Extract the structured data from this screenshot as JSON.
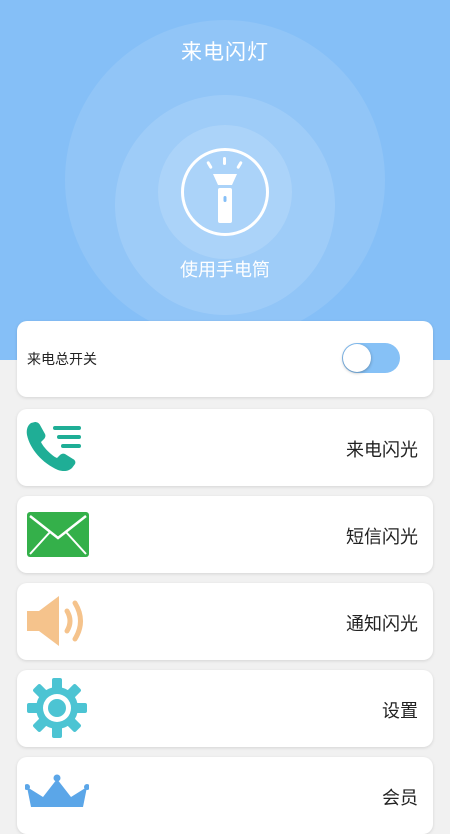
{
  "header": {
    "title": "来电闪灯",
    "flashlight_label": "使用手电筒"
  },
  "master_switch": {
    "label": "来电总开关",
    "enabled": true
  },
  "menu": {
    "items": [
      {
        "label": "来电闪光",
        "icon": "phone-list-icon"
      },
      {
        "label": "短信闪光",
        "icon": "envelope-icon"
      },
      {
        "label": "通知闪光",
        "icon": "speaker-icon"
      },
      {
        "label": "设置",
        "icon": "gear-icon"
      },
      {
        "label": "会员",
        "icon": "crown-icon"
      }
    ]
  },
  "colors": {
    "hero_background": "#85bff7",
    "toggle_on": "#86c1f6",
    "phone_icon": "#1fae96",
    "envelope_icon": "#34b04a",
    "speaker_icon": "#f5c38c",
    "gear_icon": "#4cc4d3",
    "crown_icon": "#5ba6e8"
  }
}
